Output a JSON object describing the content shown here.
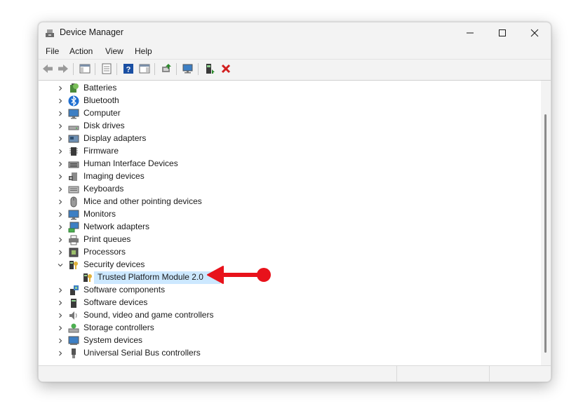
{
  "window": {
    "title": "Device Manager",
    "controls": {
      "minimize": "minimize",
      "maximize": "maximize",
      "close": "close"
    }
  },
  "menu": [
    "File",
    "Action",
    "View",
    "Help"
  ],
  "toolbar": {
    "buttons": [
      "back-icon",
      "forward-icon",
      "show-hide-console-tree-icon",
      "properties-icon",
      "help-icon",
      "action-pane-icon",
      "update-driver-icon",
      "scan-hardware-icon",
      "enable-device-icon",
      "uninstall-device-icon"
    ],
    "colors": {
      "help": "#1a4fa3",
      "uninstall": "#d21f1f",
      "enable": "#2b8a2b"
    }
  },
  "tree": {
    "items": [
      {
        "label": "Batteries",
        "icon": "battery-icon",
        "expanded": false
      },
      {
        "label": "Bluetooth",
        "icon": "bluetooth-icon",
        "expanded": false
      },
      {
        "label": "Computer",
        "icon": "computer-icon",
        "expanded": false
      },
      {
        "label": "Disk drives",
        "icon": "disk-drive-icon",
        "expanded": false
      },
      {
        "label": "Display adapters",
        "icon": "display-adapter-icon",
        "expanded": false
      },
      {
        "label": "Firmware",
        "icon": "firmware-icon",
        "expanded": false
      },
      {
        "label": "Human Interface Devices",
        "icon": "hid-icon",
        "expanded": false
      },
      {
        "label": "Imaging devices",
        "icon": "camera-icon",
        "expanded": false
      },
      {
        "label": "Keyboards",
        "icon": "keyboard-icon",
        "expanded": false
      },
      {
        "label": "Mice and other pointing devices",
        "icon": "mouse-icon",
        "expanded": false
      },
      {
        "label": "Monitors",
        "icon": "monitor-icon",
        "expanded": false
      },
      {
        "label": "Network adapters",
        "icon": "network-icon",
        "expanded": false
      },
      {
        "label": "Print queues",
        "icon": "printer-icon",
        "expanded": false
      },
      {
        "label": "Processors",
        "icon": "processor-icon",
        "expanded": false
      },
      {
        "label": "Security devices",
        "icon": "security-device-icon",
        "expanded": true
      },
      {
        "label": "Trusted Platform Module 2.0",
        "icon": "tpm-icon",
        "child": true,
        "selected": true
      },
      {
        "label": "Software components",
        "icon": "software-component-icon",
        "expanded": false
      },
      {
        "label": "Software devices",
        "icon": "software-device-icon",
        "expanded": false
      },
      {
        "label": "Sound, video and game controllers",
        "icon": "speaker-icon",
        "expanded": false
      },
      {
        "label": "Storage controllers",
        "icon": "storage-controller-icon",
        "expanded": false
      },
      {
        "label": "System devices",
        "icon": "system-device-icon",
        "expanded": false
      },
      {
        "label": "Universal Serial Bus controllers",
        "icon": "usb-icon",
        "expanded": false
      }
    ]
  },
  "annotation": {
    "arrow_color": "#e8121b",
    "points_to": "Trusted Platform Module 2.0"
  },
  "colors": {
    "selection": "#cce8ff",
    "window_bg": "#f3f3f3"
  }
}
